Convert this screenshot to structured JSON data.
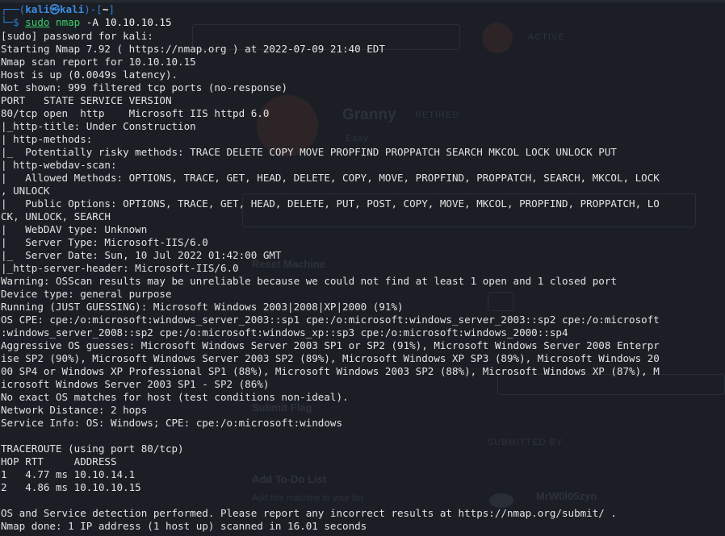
{
  "prompt": {
    "frame_open": "┌──(",
    "user": "kali",
    "at": "㉿",
    "host": "kali",
    "frame_mid": ")-[",
    "path": "~",
    "frame_close": "]",
    "frame_bottom": "└─",
    "symbol": "$",
    "command": {
      "sudo": "sudo",
      "program": "nmap",
      "args": " -A 10.10.10.15"
    }
  },
  "output_lines": [
    "[sudo] password for kali:",
    "Starting Nmap 7.92 ( https://nmap.org ) at 2022-07-09 21:40 EDT",
    "Nmap scan report for 10.10.10.15",
    "Host is up (0.0049s latency).",
    "Not shown: 999 filtered tcp ports (no-response)",
    "PORT   STATE SERVICE VERSION",
    "80/tcp open  http    Microsoft IIS httpd 6.0",
    "|_http-title: Under Construction",
    "| http-methods:",
    "|_  Potentially risky methods: TRACE DELETE COPY MOVE PROPFIND PROPPATCH SEARCH MKCOL LOCK UNLOCK PUT",
    "| http-webdav-scan:",
    "|   Allowed Methods: OPTIONS, TRACE, GET, HEAD, DELETE, COPY, MOVE, PROPFIND, PROPPATCH, SEARCH, MKCOL, LOCK",
    ", UNLOCK",
    "|   Public Options: OPTIONS, TRACE, GET, HEAD, DELETE, PUT, POST, COPY, MOVE, MKCOL, PROPFIND, PROPPATCH, LO",
    "CK, UNLOCK, SEARCH",
    "|   WebDAV type: Unknown",
    "|   Server Type: Microsoft-IIS/6.0",
    "|_  Server Date: Sun, 10 Jul 2022 01:42:00 GMT",
    "|_http-server-header: Microsoft-IIS/6.0",
    "Warning: OSScan results may be unreliable because we could not find at least 1 open and 1 closed port",
    "Device type: general purpose",
    "Running (JUST GUESSING): Microsoft Windows 2003|2008|XP|2000 (91%)",
    "OS CPE: cpe:/o:microsoft:windows_server_2003::sp1 cpe:/o:microsoft:windows_server_2003::sp2 cpe:/o:microsoft",
    ":windows_server_2008::sp2 cpe:/o:microsoft:windows_xp::sp3 cpe:/o:microsoft:windows_2000::sp4",
    "Aggressive OS guesses: Microsoft Windows Server 2003 SP1 or SP2 (91%), Microsoft Windows Server 2008 Enterpr",
    "ise SP2 (90%), Microsoft Windows Server 2003 SP2 (89%), Microsoft Windows XP SP3 (89%), Microsoft Windows 20",
    "00 SP4 or Windows XP Professional SP1 (88%), Microsoft Windows 2003 SP2 (88%), Microsoft Windows XP (87%), M",
    "icrosoft Windows Server 2003 SP1 - SP2 (86%)",
    "No exact OS matches for host (test conditions non-ideal).",
    "Network Distance: 2 hops",
    "Service Info: OS: Windows; CPE: cpe:/o:microsoft:windows",
    "",
    "TRACEROUTE (using port 80/tcp)",
    "HOP RTT     ADDRESS",
    "1   4.77 ms 10.10.14.1",
    "2   4.86 ms 10.10.10.15",
    "",
    "OS and Service detection performed. Please report any incorrect results at https://nmap.org/submit/ .",
    "Nmap done: 1 IP address (1 host up) scanned in 16.01 seconds"
  ],
  "background_page": {
    "badge": "ACTIVE",
    "machine_name": "Granny",
    "machine_status": "RETIRED",
    "difficulty": "Easy",
    "reset_label": "Reset Machine",
    "submit_label": "Submit Flag",
    "submitted_by_label": "SUBMITTED BY",
    "author": "MrW0l05zyn",
    "todo_label": "Add To-Do List",
    "todo_hint": "Add this machine to your list"
  },
  "colors": {
    "background": "#1b1f25",
    "text": "#e2e2e2",
    "prompt_blue": "#2f7fd8",
    "command_green": "#3ccf68"
  }
}
